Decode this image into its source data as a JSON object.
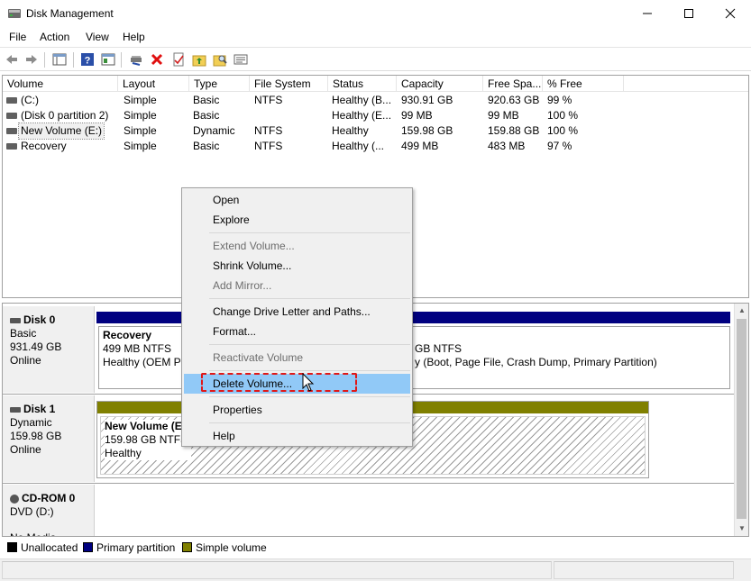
{
  "window": {
    "title": "Disk Management",
    "app_icon": "disk-management-icon"
  },
  "menu": [
    "File",
    "Action",
    "View",
    "Help"
  ],
  "toolbar": {
    "icons": [
      "back-icon",
      "forward-icon",
      "show-hide-console-tree-icon",
      "help-icon",
      "properties-pane-icon",
      "connect-drive-icon",
      "delete-icon",
      "check-icon",
      "up-folder-icon",
      "search-folder-icon",
      "settings-list-icon"
    ]
  },
  "volume_list": {
    "columns": [
      "Volume",
      "Layout",
      "Type",
      "File System",
      "Status",
      "Capacity",
      "Free Spa...",
      "% Free"
    ],
    "rows": [
      {
        "volume": "(C:)",
        "layout": "Simple",
        "type": "Basic",
        "fs": "NTFS",
        "status": "Healthy (B...",
        "capacity": "930.91 GB",
        "free": "920.63 GB",
        "pct": "99 %"
      },
      {
        "volume": "(Disk 0 partition 2)",
        "layout": "Simple",
        "type": "Basic",
        "fs": "",
        "status": "Healthy (E...",
        "capacity": "99 MB",
        "free": "99 MB",
        "pct": "100 %"
      },
      {
        "volume": "New Volume (E:)",
        "layout": "Simple",
        "type": "Dynamic",
        "fs": "NTFS",
        "status": "Healthy",
        "capacity": "159.98 GB",
        "free": "159.88 GB",
        "pct": "100 %"
      },
      {
        "volume": "Recovery",
        "layout": "Simple",
        "type": "Basic",
        "fs": "NTFS",
        "status": "Healthy (...",
        "capacity": "499 MB",
        "free": "483 MB",
        "pct": "97 %"
      }
    ]
  },
  "disks": [
    {
      "name": "Disk 0",
      "type": "Basic",
      "size": "931.49 GB",
      "state": "Online",
      "part_a": {
        "name": "Recovery",
        "line2": "499 MB NTFS",
        "line3": "Healthy (OEM Pa"
      },
      "part_b": {
        "line2": "GB NTFS",
        "line3": "y (Boot, Page File, Crash Dump, Primary Partition)"
      }
    },
    {
      "name": "Disk 1",
      "type": "Dynamic",
      "size": "159.98 GB",
      "state": "Online",
      "part_a": {
        "name": "New Volume  (E",
        "line2": "159.98 GB NTFS",
        "line3": "Healthy"
      }
    },
    {
      "name": "CD-ROM 0",
      "type": "DVD (D:)",
      "state": "No Media"
    }
  ],
  "legend": [
    {
      "label": "Unallocated",
      "color": "#000000"
    },
    {
      "label": "Primary partition",
      "color": "#000080"
    },
    {
      "label": "Simple volume",
      "color": "#808000"
    }
  ],
  "context_menu": {
    "open": "Open",
    "explore": "Explore",
    "extend": "Extend Volume...",
    "shrink": "Shrink Volume...",
    "add_mirror": "Add Mirror...",
    "change_letter": "Change Drive Letter and Paths...",
    "format": "Format...",
    "reactivate": "Reactivate Volume",
    "delete": "Delete Volume...",
    "properties": "Properties",
    "help": "Help"
  },
  "colors": {
    "primary_partition": "#000080",
    "simple_volume": "#808000",
    "menu_highlight": "#91c9f7",
    "annotation_red": "#e01818"
  }
}
